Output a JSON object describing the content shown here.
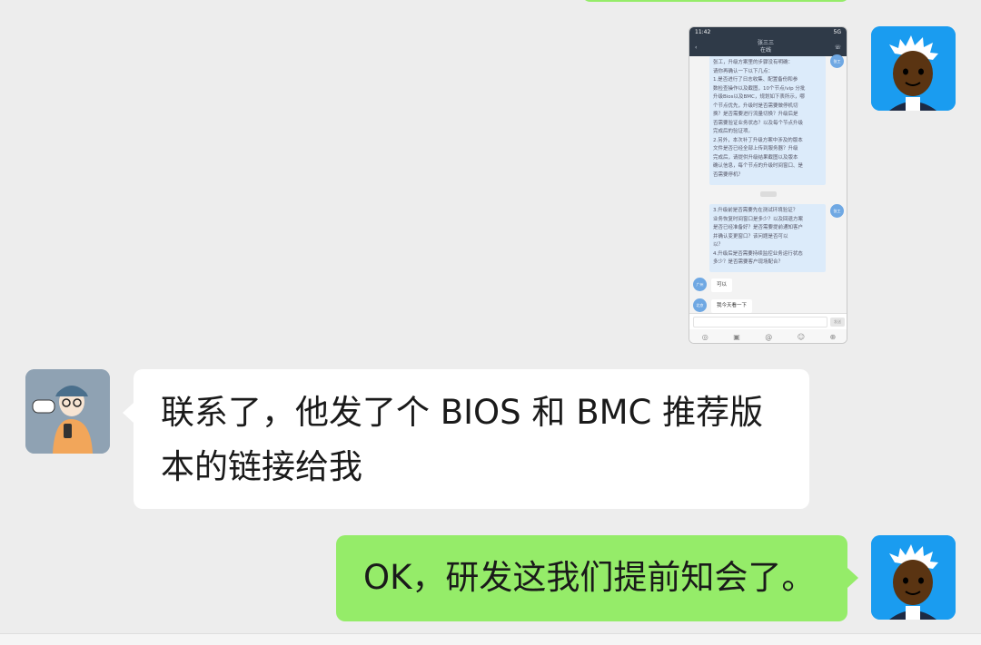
{
  "messages": [
    {
      "id": "m1",
      "sender": "me",
      "type": "image",
      "thumbnail": {
        "status_time": "11:42",
        "status_right": "5G",
        "header_title": "张三三",
        "header_sub": "在线",
        "msg1": "张工，升级方案里的步骤没有明确：\n请你再确认一下以下几点：\n1.是否进行了日志收集、配置备份和参\n数检查操作以及截图，10个节点/vip 分批\n升级Bios以及BMC，规划如下表所示，哪\n个节点优先，升级时是否需要做停机切\n换？是否需要进行流量切换？升级后是\n否需要验证业务状态？以及每个节点升级\n完成后的验证项。\n2.另外，本次补丁升级方案中涉及的版本\n文件是否已经全部上传到服务器？升级\n完成后，请提供升级结果截图以及版本\n确认信息，每个节点的升级时间窗口、是\n否需要停机？",
        "msg2": "3.升级前是否需要先在测试环境验证？\n业务恢复时间窗口是多少？以及回退方案\n是否已经准备好？是否需要提前通知客户\n并确认变更窗口？该问题是否可以\n以？\n4.升级后是否需要持续监控业务运行状态\n多少？是否需要客户现场配合？",
        "avatar1": "张工",
        "avatar2": "张工",
        "reply1_avatar": "广州",
        "reply1": "可以",
        "reply2_avatar": "北京",
        "reply2": "我今天看一下",
        "send": "发送"
      }
    },
    {
      "id": "m2",
      "sender": "other",
      "type": "text",
      "text": "联系了，他发了个 BIOS 和 BMC 推荐版本的链接给我"
    },
    {
      "id": "m3",
      "sender": "me",
      "type": "text",
      "text": "OK，研发这我们提前知会了。"
    }
  ],
  "colors": {
    "background": "#ededed",
    "bubble_out": "#95ec69",
    "bubble_in": "#ffffff",
    "avatar_me_bg": "#1a9cf0"
  },
  "icons": {
    "thumb_tools": [
      "mic-icon",
      "image-icon",
      "at-icon",
      "emoji-icon",
      "more-icon"
    ]
  }
}
